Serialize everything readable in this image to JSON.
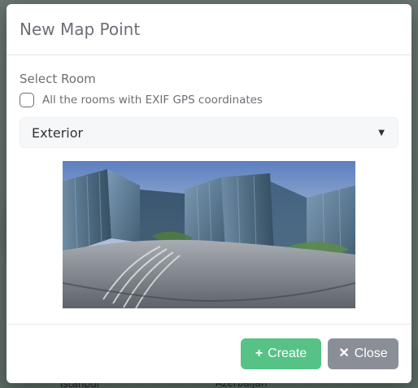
{
  "modal": {
    "title": "New Map Point",
    "section_label": "Select Room",
    "checkbox_label": "All the rooms with EXIF GPS coordinates",
    "select_value": "Exterior",
    "buttons": {
      "create": "Create",
      "close": "Close"
    }
  },
  "map_labels": {
    "bottom_left": "İstanbul",
    "bottom_right": "Azerbaijan"
  },
  "icons": {
    "dropdown": "chevron-down-icon",
    "create": "plus-icon",
    "close": "close-icon"
  },
  "colors": {
    "create": "#57c286",
    "close": "#8a8f97",
    "title": "#6b6f75"
  }
}
